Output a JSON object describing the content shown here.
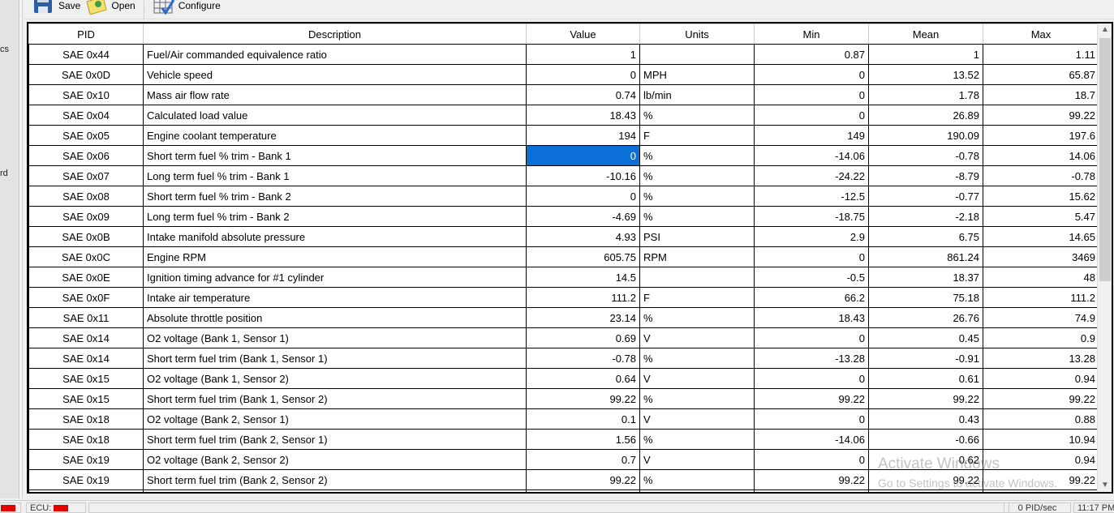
{
  "toolbar": {
    "save": "Save",
    "open": "Open",
    "configure": "Configure"
  },
  "left_panel": {
    "text1": "cs",
    "text2": "rd"
  },
  "columns": [
    "PID",
    "Description",
    "Value",
    "Units",
    "Min",
    "Mean",
    "Max"
  ],
  "rows": [
    [
      "SAE 0x44",
      "Fuel/Air commanded equivalence ratio",
      "1",
      "",
      "0.87",
      "1",
      "1.11"
    ],
    [
      "SAE 0x0D",
      "Vehicle speed",
      "0",
      "MPH",
      "0",
      "13.52",
      "65.87"
    ],
    [
      "SAE 0x10",
      "Mass air flow rate",
      "0.74",
      "lb/min",
      "0",
      "1.78",
      "18.7"
    ],
    [
      "SAE 0x04",
      "Calculated load value",
      "18.43",
      "%",
      "0",
      "26.89",
      "99.22"
    ],
    [
      "SAE 0x05",
      "Engine coolant temperature",
      "194",
      "F",
      "149",
      "190.09",
      "197.6"
    ],
    [
      "SAE 0x06",
      "Short term fuel % trim - Bank 1",
      "0",
      "%",
      "-14.06",
      "-0.78",
      "14.06"
    ],
    [
      "SAE 0x07",
      "Long term fuel % trim - Bank 1",
      "-10.16",
      "%",
      "-24.22",
      "-8.79",
      "-0.78"
    ],
    [
      "SAE 0x08",
      "Short term fuel % trim - Bank 2",
      "0",
      "%",
      "-12.5",
      "-0.77",
      "15.62"
    ],
    [
      "SAE 0x09",
      "Long term fuel % trim - Bank 2",
      "-4.69",
      "%",
      "-18.75",
      "-2.18",
      "5.47"
    ],
    [
      "SAE 0x0B",
      "Intake manifold absolute pressure",
      "4.93",
      "PSI",
      "2.9",
      "6.75",
      "14.65"
    ],
    [
      "SAE 0x0C",
      "Engine RPM",
      "605.75",
      "RPM",
      "0",
      "861.24",
      "3469"
    ],
    [
      "SAE 0x0E",
      "Ignition timing advance for #1 cylinder",
      "14.5",
      "",
      "-0.5",
      "18.37",
      "48"
    ],
    [
      "SAE 0x0F",
      "Intake air temperature",
      "111.2",
      "F",
      "66.2",
      "75.18",
      "111.2"
    ],
    [
      "SAE 0x11",
      "Absolute throttle position",
      "23.14",
      "%",
      "18.43",
      "26.76",
      "74.9"
    ],
    [
      "SAE 0x14",
      "O2 voltage (Bank 1, Sensor 1)",
      "0.69",
      "V",
      "0",
      "0.45",
      "0.9"
    ],
    [
      "SAE 0x14",
      "Short term fuel trim (Bank 1, Sensor 1)",
      "-0.78",
      "%",
      "-13.28",
      "-0.91",
      "13.28"
    ],
    [
      "SAE 0x15",
      "O2 voltage (Bank 1, Sensor 2)",
      "0.64",
      "V",
      "0",
      "0.61",
      "0.94"
    ],
    [
      "SAE 0x15",
      "Short term fuel trim (Bank 1, Sensor 2)",
      "99.22",
      "%",
      "99.22",
      "99.22",
      "99.22"
    ],
    [
      "SAE 0x18",
      "O2 voltage (Bank 2, Sensor 1)",
      "0.1",
      "V",
      "0",
      "0.43",
      "0.88"
    ],
    [
      "SAE 0x18",
      "Short term fuel trim (Bank 2, Sensor 1)",
      "1.56",
      "%",
      "-14.06",
      "-0.66",
      "10.94"
    ],
    [
      "SAE 0x19",
      "O2 voltage (Bank 2, Sensor 2)",
      "0.7",
      "V",
      "0",
      "0.62",
      "0.94"
    ],
    [
      "SAE 0x19",
      "Short term fuel trim (Bank 2, Sensor 2)",
      "99.22",
      "%",
      "99.22",
      "99.22",
      "99.22"
    ]
  ],
  "selected_cell": {
    "row": 5,
    "column": "Value"
  },
  "status": {
    "ecu_label": "ECU:",
    "rate": "0 PID/sec",
    "time": "11:17 PM"
  },
  "watermark": {
    "title": "Activate Windows",
    "subtitle": "Go to Settings to activate Windows."
  },
  "colors": {
    "selection": "#0a6fd6",
    "indicator": "#e00000"
  }
}
